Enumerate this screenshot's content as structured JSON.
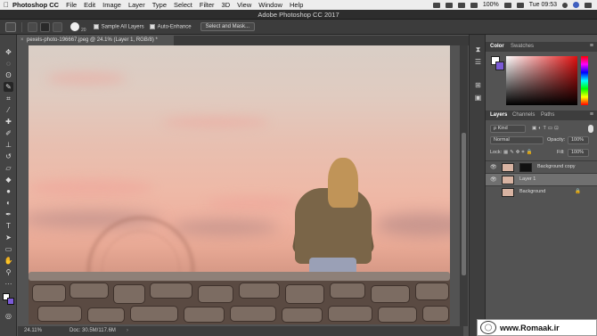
{
  "menubar": {
    "app_name": "Photoshop CC",
    "items": [
      "File",
      "Edit",
      "Image",
      "Layer",
      "Type",
      "Select",
      "Filter",
      "3D",
      "View",
      "Window",
      "Help"
    ],
    "battery": "100%",
    "clock": "Tue 09:53"
  },
  "titlebar": {
    "title": "Adobe Photoshop CC 2017"
  },
  "options": {
    "brush_size": "20",
    "sample_all_layers": "Sample All Layers",
    "auto_enhance": "Auto-Enhance",
    "select_and_mask": "Select and Mask..."
  },
  "document": {
    "tab_title": "pexels-photo-196667.jpeg @ 24.1% (Layer 1, RGB/8) *",
    "zoom": "24.11%",
    "doc_info": "Doc: 30.5M/117.6M"
  },
  "color_panel": {
    "tabs": [
      "Color",
      "Swatches"
    ],
    "fg_color": "#ffffff",
    "bg_color": "#7b5bd6"
  },
  "layers_panel": {
    "tabs": [
      "Layers",
      "Channels",
      "Paths"
    ],
    "filter_label": "ρ Kind",
    "blend_mode": "Normal",
    "opacity_label": "Opacity:",
    "opacity_value": "100%",
    "lock_label": "Lock:",
    "fill_label": "Fill:",
    "fill_value": "100%",
    "layers": [
      {
        "name": "Background copy",
        "visible": true,
        "selected": false,
        "has_mask": true
      },
      {
        "name": "Layer 1",
        "visible": true,
        "selected": true,
        "has_mask": false
      },
      {
        "name": "Background",
        "visible": false,
        "selected": false,
        "locked": true
      }
    ]
  },
  "watermark": {
    "text": "www.Romaak.ir"
  }
}
